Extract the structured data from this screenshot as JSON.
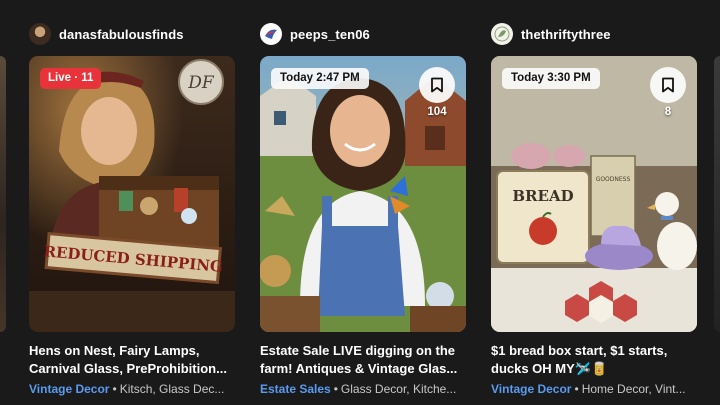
{
  "cards": [
    {
      "seller": "danasfabulousfinds",
      "badge": "Live · 11",
      "title": "Hens on Nest, Fairy Lamps, Carnival Glass, PreProhibition...",
      "category": "Vintage Decor",
      "tags": "Kitsch, Glass Dec...",
      "sign_text": "REDUCED SHIPPING",
      "logo_text": "DF"
    },
    {
      "seller": "peeps_ten06",
      "badge": "Today 2:47 PM",
      "bookmark_count": "104",
      "title": "Estate Sale LIVE digging on the farm! Antiques & Vintage Glas...",
      "category": "Estate Sales",
      "tags": "Glass Decor, Kitche..."
    },
    {
      "seller": "thethriftythree",
      "badge": "Today 3:30 PM",
      "bookmark_count": "8",
      "title": "$1 bread box start, $1 starts, ducks OH MY🛩️🥫",
      "category": "Vintage Decor",
      "tags": "Home Decor, Vint...",
      "box_text": "BREAD",
      "tin_text": "GOODNESS"
    }
  ],
  "icons": {
    "bookmark": "bookmark-icon"
  },
  "colors": {
    "background": "#1a1a1a",
    "live": "#e8333b",
    "category": "#5a9bf0"
  }
}
